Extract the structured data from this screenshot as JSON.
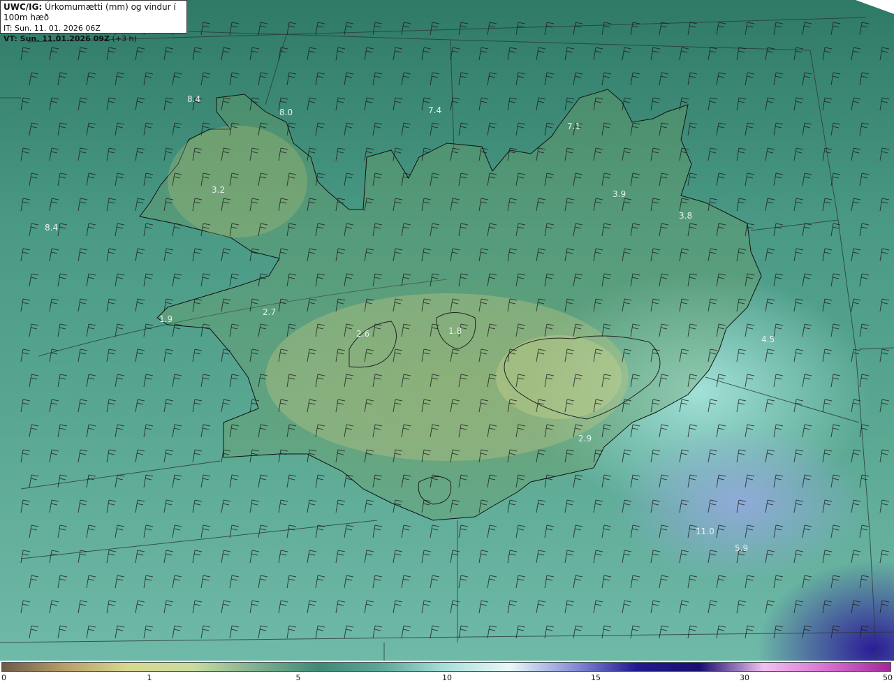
{
  "header": {
    "model": "UWC/IG:",
    "product": "Úrkomumætti (mm) og vindur í 100m hæð",
    "issue_time": "IT: Sun. 11. 01. 2026 06Z",
    "valid_label": "VT: Sun. 11.01.2026 09Z",
    "valid_offset": "(+3 h)"
  },
  "map_labels": [
    {
      "text": "8.4"
    },
    {
      "text": "8.0"
    },
    {
      "text": "7.4"
    },
    {
      "text": "7.1"
    },
    {
      "text": "3.2"
    },
    {
      "text": "3.9"
    },
    {
      "text": "3.8"
    },
    {
      "text": "8.4"
    },
    {
      "text": "1.9"
    },
    {
      "text": "2.7"
    },
    {
      "text": "2.6"
    },
    {
      "text": "1.8"
    },
    {
      "text": "2.9"
    },
    {
      "text": "4.5"
    },
    {
      "text": "11.0"
    },
    {
      "text": "5.9"
    }
  ],
  "colorbar": {
    "ticks": [
      "0",
      "1",
      "5",
      "10",
      "15",
      "30",
      "50"
    ],
    "colors": [
      "#6b5a4a",
      "#b8a068",
      "#d8d890",
      "#c8dca0",
      "#7fb090",
      "#3e8a76",
      "#5fa89a",
      "#a8e0dc",
      "#e8f8f8",
      "#8890d8",
      "#201a90",
      "#1a1070",
      "#f0c0f0",
      "#d870d0",
      "#a02898"
    ]
  }
}
